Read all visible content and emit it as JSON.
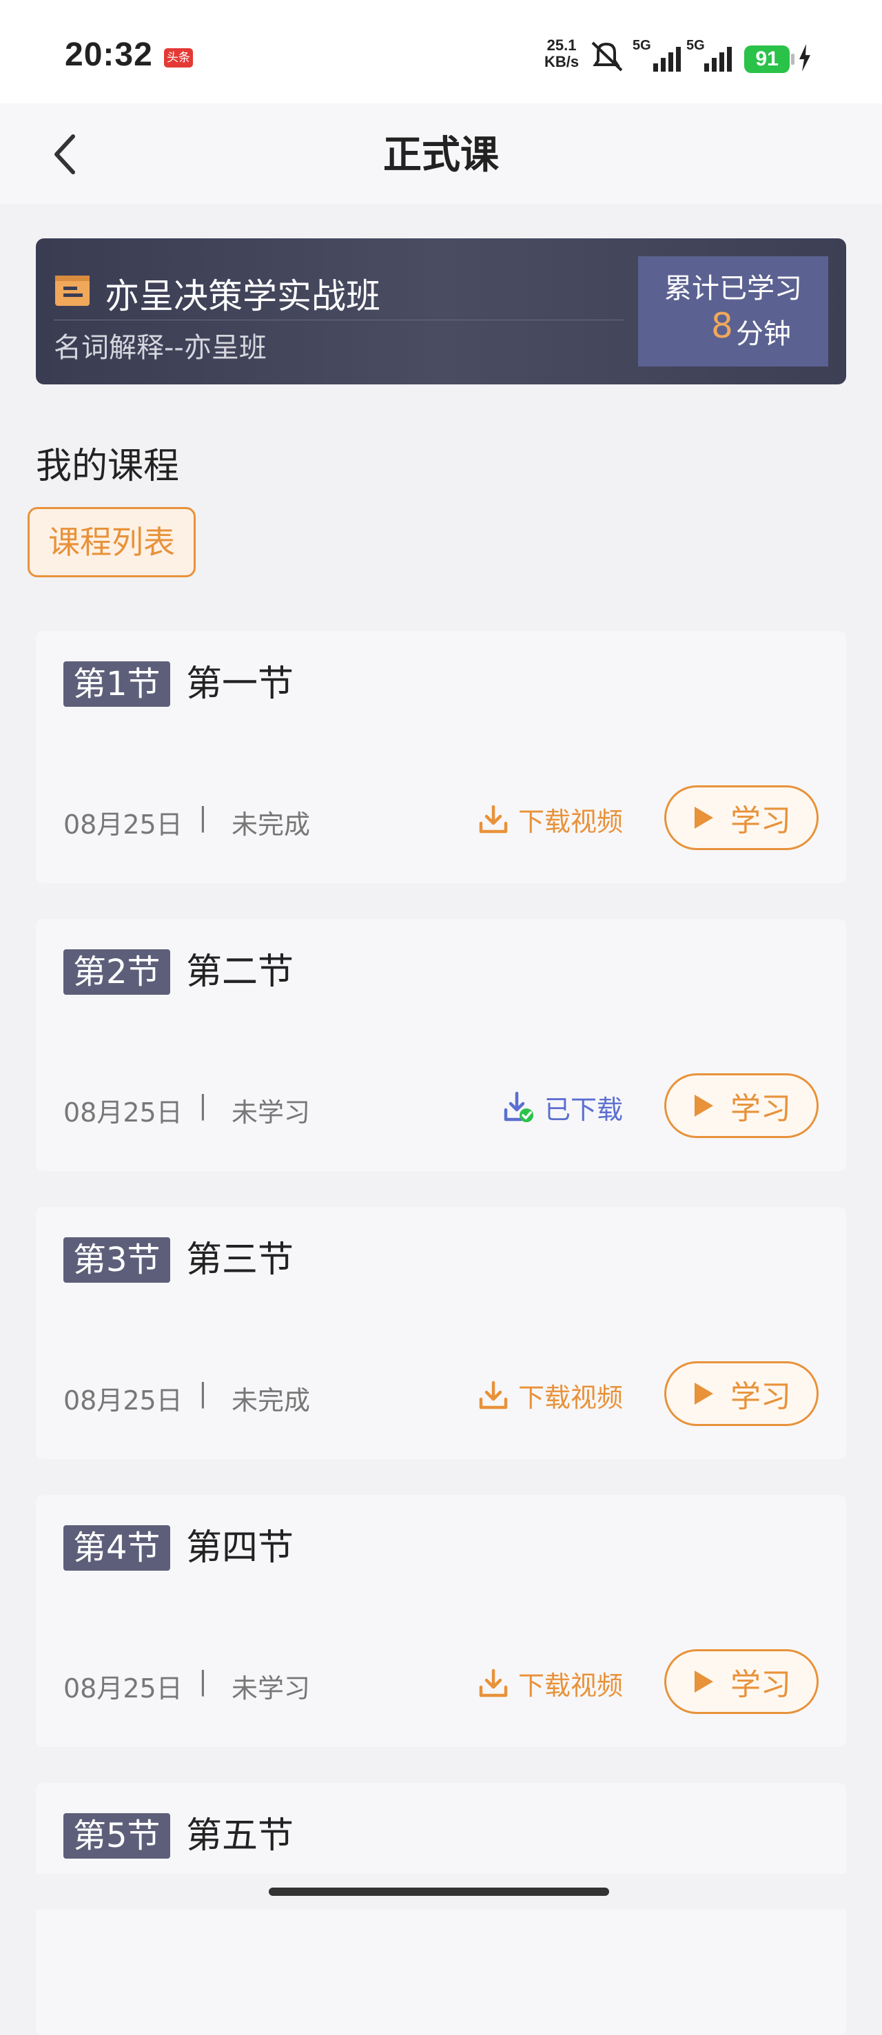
{
  "status_bar": {
    "time": "20:32",
    "badge": "头条",
    "speed_value": "25.1",
    "speed_unit": "KB/s",
    "net1": "5G",
    "net2": "5G",
    "battery": "91"
  },
  "nav": {
    "title": "正式课"
  },
  "class_card": {
    "name": "亦呈决策学实战班",
    "subtitle": "名词解释--亦呈班",
    "study_label": "累计已学习",
    "study_value": "8",
    "study_unit": "分钟"
  },
  "section": {
    "title": "我的课程",
    "tab": "课程列表"
  },
  "lessons": [
    {
      "tag": "第1节",
      "name": "第一节",
      "date": "08月25日",
      "sep": "|",
      "status": "未完成",
      "download": "下载视频",
      "downloaded": false,
      "play": "学习"
    },
    {
      "tag": "第2节",
      "name": "第二节",
      "date": "08月25日",
      "sep": "|",
      "status": "未学习",
      "download": "已下载",
      "downloaded": true,
      "play": "学习"
    },
    {
      "tag": "第3节",
      "name": "第三节",
      "date": "08月25日",
      "sep": "|",
      "status": "未完成",
      "download": "下载视频",
      "downloaded": false,
      "play": "学习"
    },
    {
      "tag": "第4节",
      "name": "第四节",
      "date": "08月25日",
      "sep": "|",
      "status": "未学习",
      "download": "下载视频",
      "downloaded": false,
      "play": "学习"
    },
    {
      "tag": "第5节",
      "name": "第五节"
    }
  ],
  "colors": {
    "accent": "#e8923a",
    "card_bg": "#3a3c52",
    "tag_bg": "#5d5f7a",
    "downloaded": "#5b6ed0",
    "battery": "#2bc24a"
  }
}
